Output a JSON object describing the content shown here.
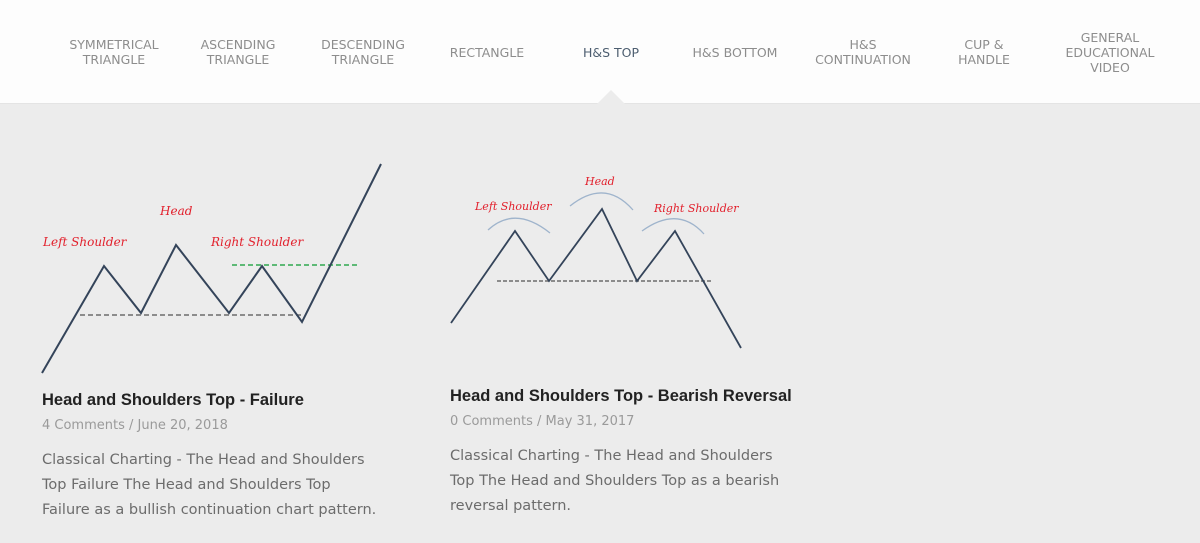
{
  "nav": {
    "tabs": [
      {
        "label": "SYMMETRICAL\nTRIANGLE",
        "active": false
      },
      {
        "label": "ASCENDING\nTRIANGLE",
        "active": false
      },
      {
        "label": "DESCENDING\nTRIANGLE",
        "active": false
      },
      {
        "label": "RECTANGLE",
        "active": false
      },
      {
        "label": "H&S TOP",
        "active": true
      },
      {
        "label": "H&S BOTTOM",
        "active": false
      },
      {
        "label": "H&S\nCONTINUATION",
        "active": false
      },
      {
        "label": "CUP &\nHANDLE",
        "active": false
      },
      {
        "label": "GENERAL\nEDUCATIONAL\nVIDEO",
        "active": false
      }
    ]
  },
  "posts": [
    {
      "title": "Head and Shoulders Top - Failure",
      "comments": "4 Comments",
      "separator": " / ",
      "date": "June 20, 2018",
      "excerpt": "Classical Charting - The Head and Shoulders Top Failure The Head and Shoulders Top Failure as a bullish continuation chart pattern.",
      "image_labels": {
        "left": "Left Shoulder",
        "head": "Head",
        "right": "Right Shoulder"
      }
    },
    {
      "title": "Head and Shoulders Top - Bearish Reversal",
      "comments": "0 Comments",
      "separator": " / ",
      "date": "May 31, 2017",
      "excerpt": "Classical Charting - The Head and Shoulders Top The Head and Shoulders Top as a bearish reversal pattern.",
      "image_labels": {
        "left": "Left Shoulder",
        "head": "Head",
        "right": "Right Shoulder"
      }
    }
  ],
  "colors": {
    "line": "#34445a",
    "neckline": "#6d6d6d",
    "breakout": "#2fa84f",
    "label": "#e2202c",
    "arc": "#9fb4cc"
  }
}
